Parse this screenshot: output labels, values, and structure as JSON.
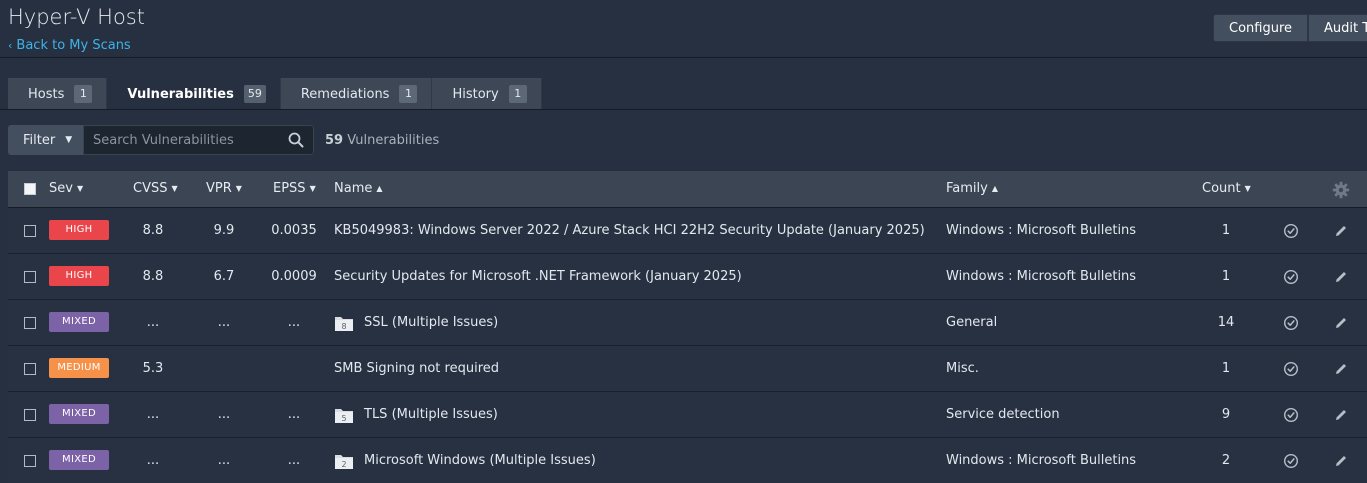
{
  "header": {
    "title": "Hyper-V Host",
    "back_link": "Back to My Scans",
    "buttons": [
      "Configure",
      "Audit Tr"
    ]
  },
  "tabs": [
    {
      "label": "Hosts",
      "count": "1"
    },
    {
      "label": "Vulnerabilities",
      "count": "59"
    },
    {
      "label": "Remediations",
      "count": "1"
    },
    {
      "label": "History",
      "count": "1"
    }
  ],
  "toolbar": {
    "filter_label": "Filter",
    "search_placeholder": "Search Vulnerabilities",
    "count_number": "59",
    "count_label": "Vulnerabilities"
  },
  "table": {
    "columns": {
      "sev": "Sev",
      "cvss": "CVSS",
      "vpr": "VPR",
      "epss": "EPSS",
      "name": "Name",
      "family": "Family",
      "count": "Count"
    },
    "rows": [
      {
        "sev": "HIGH",
        "cvss": "8.8",
        "vpr": "9.9",
        "epss": "0.0035",
        "group_count": "",
        "name": "KB5049983: Windows Server 2022 / Azure Stack HCI 22H2 Security Update (January 2025)",
        "family": "Windows : Microsoft Bulletins",
        "count": "1"
      },
      {
        "sev": "HIGH",
        "cvss": "8.8",
        "vpr": "6.7",
        "epss": "0.0009",
        "group_count": "",
        "name": "Security Updates for Microsoft .NET Framework (January 2025)",
        "family": "Windows : Microsoft Bulletins",
        "count": "1"
      },
      {
        "sev": "MIXED",
        "cvss": "...",
        "vpr": "...",
        "epss": "...",
        "group_count": "8",
        "name": "SSL (Multiple Issues)",
        "family": "General",
        "count": "14"
      },
      {
        "sev": "MEDIUM",
        "cvss": "5.3",
        "vpr": "",
        "epss": "",
        "group_count": "",
        "name": "SMB Signing not required",
        "family": "Misc.",
        "count": "1"
      },
      {
        "sev": "MIXED",
        "cvss": "...",
        "vpr": "...",
        "epss": "...",
        "group_count": "5",
        "name": "TLS (Multiple Issues)",
        "family": "Service detection",
        "count": "9"
      },
      {
        "sev": "MIXED",
        "cvss": "...",
        "vpr": "...",
        "epss": "...",
        "group_count": "2",
        "name": "Microsoft Windows (Multiple Issues)",
        "family": "Windows : Microsoft Bulletins",
        "count": "2"
      }
    ]
  },
  "colors": {
    "high": "#e9454a",
    "medium": "#f6914a",
    "mixed": "#7c62a6",
    "link": "#3fb3e8"
  },
  "icons": [
    "chevron-left-icon",
    "caret-down-icon",
    "search-icon",
    "gear-icon",
    "folder-icon",
    "check-circle-icon",
    "pencil-icon"
  ]
}
